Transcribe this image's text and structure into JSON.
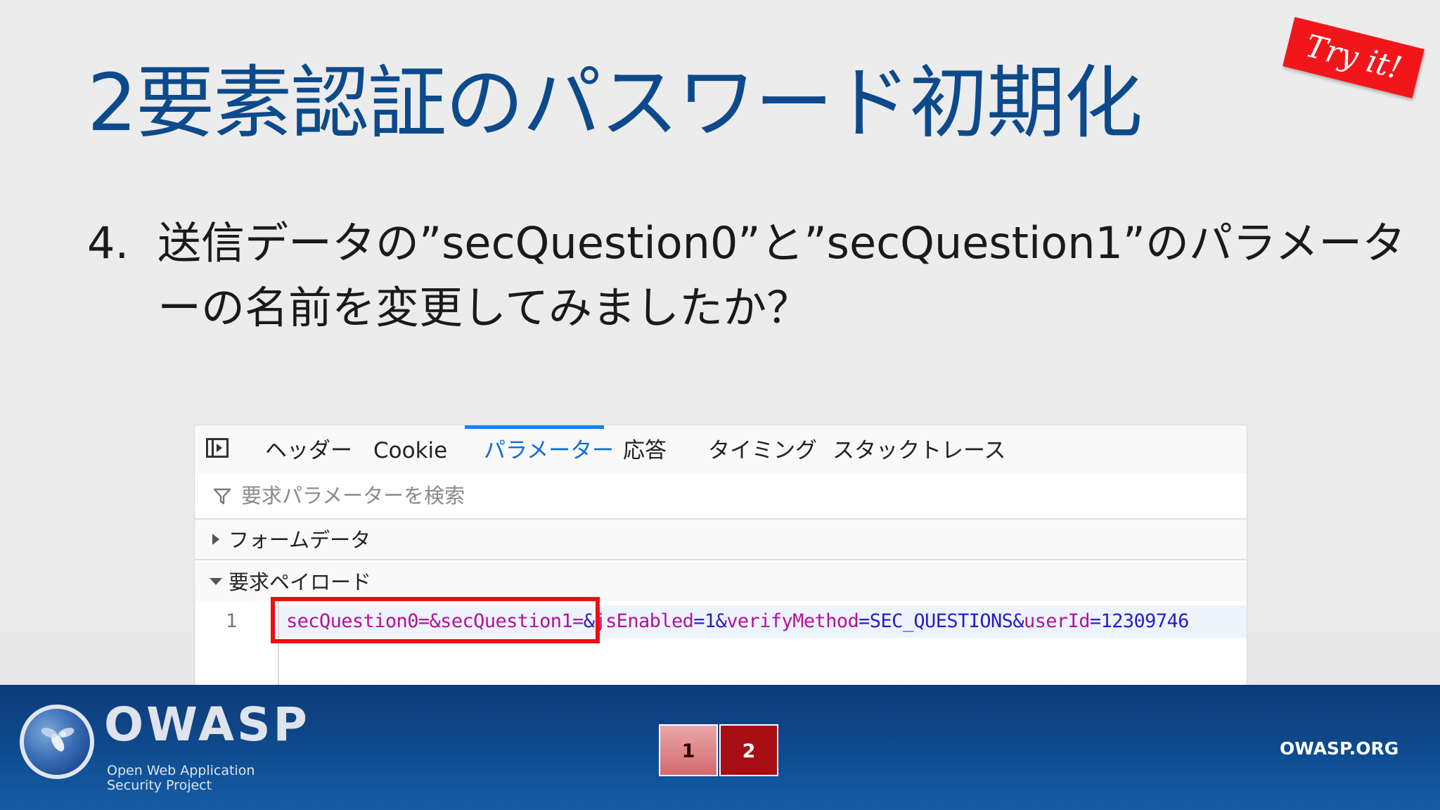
{
  "slide": {
    "title": "2要素認証のパスワード初期化",
    "badge": "Try it!",
    "question_number": "4.",
    "question_text": "送信データの”secQuestion0”と”secQuestion1”のパラメーターの名前を変更してみましたか？"
  },
  "devtools": {
    "tabs": [
      "ヘッダー",
      "Cookie",
      "パラメーター",
      "応答",
      "タイミング",
      "スタックトレース"
    ],
    "active_tab": "パラメーター",
    "filter_placeholder": "要求パラメーターを検索",
    "sections": {
      "form_data": "フォームデータ",
      "request_payload": "要求ペイロード"
    },
    "payload": {
      "line_number": "1",
      "highlighted": "secQuestion0=&secQuestion1=",
      "rest_parts": {
        "p1k": "jsEnabled",
        "p1v": "1",
        "p2k": "verifyMethod",
        "p2v": "SEC_QUESTIONS",
        "p3k": "userId",
        "p3v": "12309746"
      }
    }
  },
  "footer": {
    "logo_word": "OWASP",
    "logo_sub_1": "Open Web Application",
    "logo_sub_2": "Security Project",
    "page_1": "1",
    "page_2": "2",
    "current_page": "2",
    "site": "OWASP.ORG"
  },
  "colors": {
    "title": "#0d4a8c",
    "badge": "#f2161b",
    "active_tab": "#0a84ff",
    "highlight_box": "#f20b12",
    "footer_bg": "#0e4c8f",
    "current_page_bg": "#a80d13"
  }
}
